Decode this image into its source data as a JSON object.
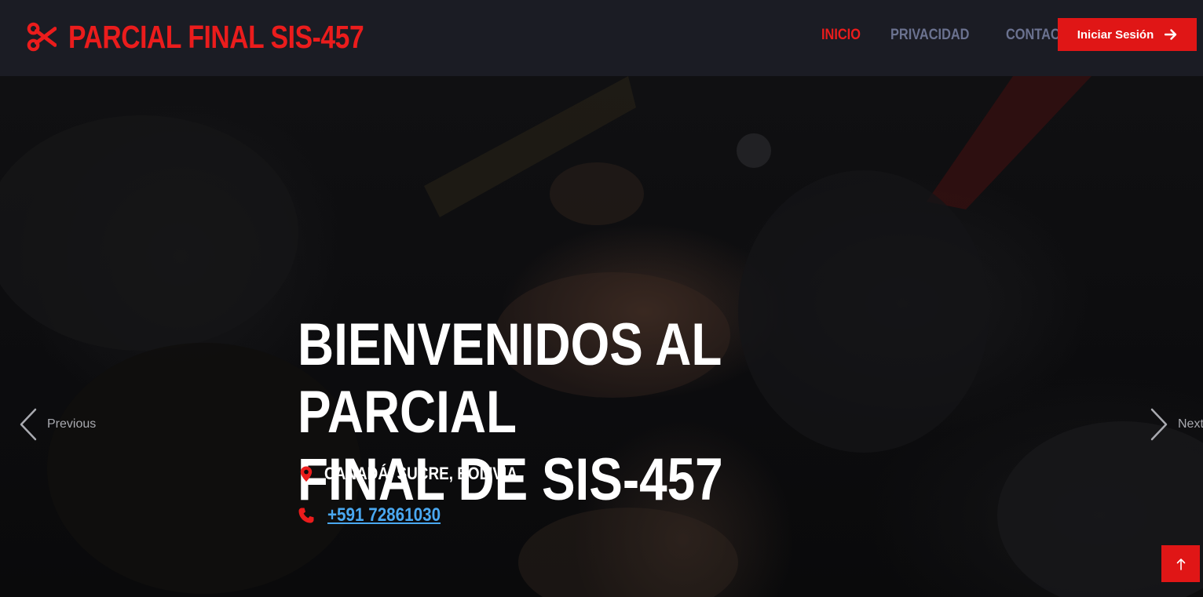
{
  "brand": {
    "name": "PARCIAL FINAL SIS-457",
    "icon": "scissors-icon",
    "color": "#eb1c1c"
  },
  "nav": {
    "items": [
      {
        "label": "INICIO",
        "active": true
      },
      {
        "label": "PRIVACIDAD",
        "active": false
      },
      {
        "label": "CONTACTO",
        "active": false
      }
    ],
    "login_label": "Iniciar Sesión",
    "login_icon": "arrow-right-icon"
  },
  "hero": {
    "title_line1": "BIENVENIDOS AL PARCIAL",
    "title_line2": "FINAL DE SIS-457",
    "location": "CANADÁ, SUCRE, BOLIVIA",
    "location_icon": "map-pin-icon",
    "phone": "+591 72861030",
    "phone_icon": "phone-icon"
  },
  "carousel": {
    "prev_label": "Previous",
    "next_label": "Next"
  },
  "back_to_top_icon": "arrow-up-icon",
  "colors": {
    "accent": "#e01616",
    "navbar_bg": "#1b1c24",
    "nav_inactive": "#6b7290",
    "link": "#4aa8f0"
  }
}
